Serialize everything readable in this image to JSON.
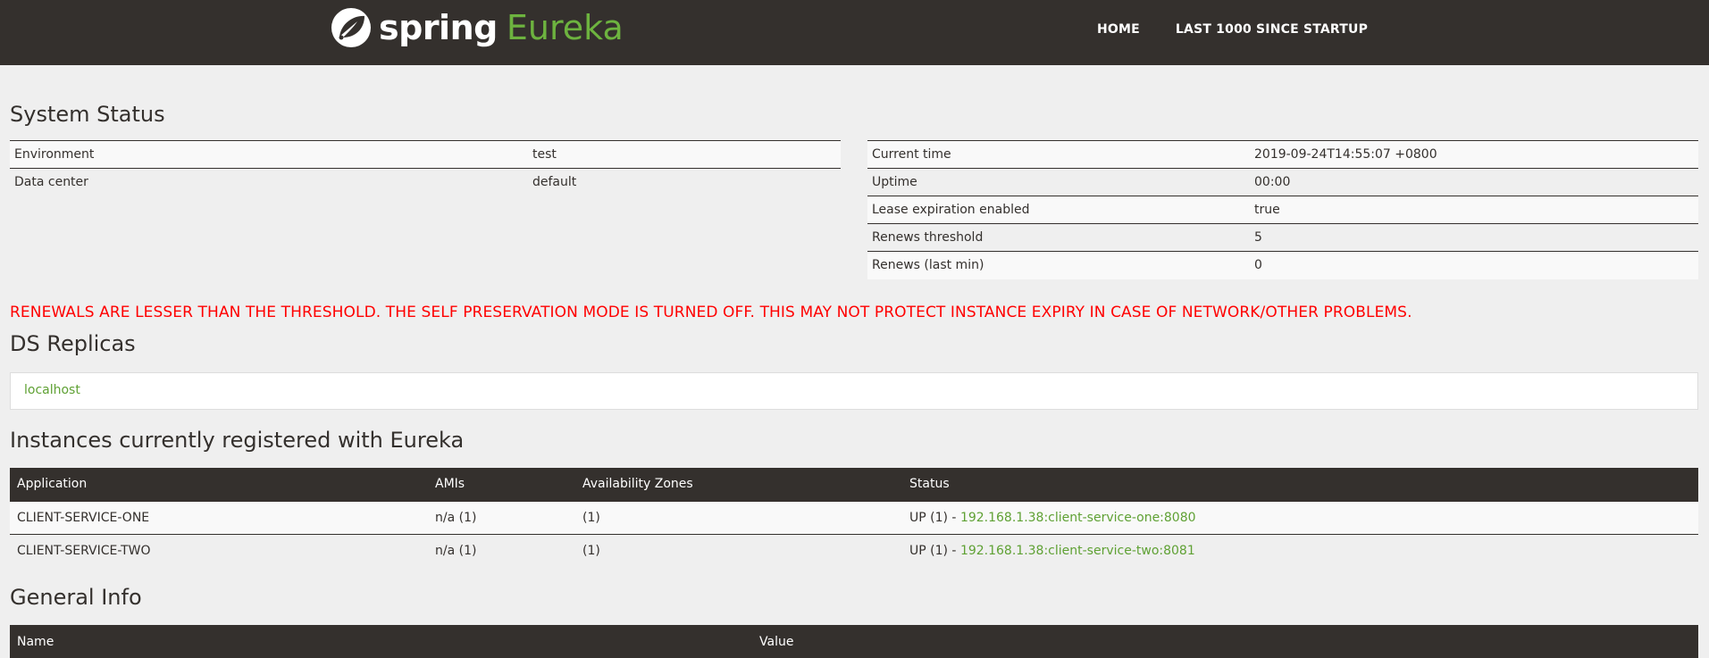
{
  "navbar": {
    "brand_primary": "spring",
    "brand_secondary": "Eureka",
    "links": [
      "HOME",
      "LAST 1000 SINCE STARTUP"
    ]
  },
  "system_status": {
    "title": "System Status",
    "left_rows": [
      {
        "label": "Environment",
        "value": "test"
      },
      {
        "label": "Data center",
        "value": "default"
      }
    ],
    "right_rows": [
      {
        "label": "Current time",
        "value": "2019-09-24T14:55:07 +0800"
      },
      {
        "label": "Uptime",
        "value": "00:00"
      },
      {
        "label": "Lease expiration enabled",
        "value": "true"
      },
      {
        "label": "Renews threshold",
        "value": "5"
      },
      {
        "label": "Renews (last min)",
        "value": "0"
      }
    ]
  },
  "warning": "RENEWALS ARE LESSER THAN THE THRESHOLD. THE SELF PRESERVATION MODE IS TURNED OFF. THIS MAY NOT PROTECT INSTANCE EXPIRY IN CASE OF NETWORK/OTHER PROBLEMS.",
  "ds_replicas": {
    "title": "DS Replicas",
    "items": [
      "localhost"
    ]
  },
  "instances": {
    "title": "Instances currently registered with Eureka",
    "columns": [
      "Application",
      "AMIs",
      "Availability Zones",
      "Status"
    ],
    "rows": [
      {
        "application": "CLIENT-SERVICE-ONE",
        "amis": "n/a (1)",
        "zones": "(1)",
        "status_prefix": "UP (1) - ",
        "status_link": "192.168.1.38:client-service-one:8080"
      },
      {
        "application": "CLIENT-SERVICE-TWO",
        "amis": "n/a (1)",
        "zones": "(1)",
        "status_prefix": "UP (1) - ",
        "status_link": "192.168.1.38:client-service-two:8081"
      }
    ]
  },
  "general_info": {
    "title": "General Info",
    "columns": [
      "Name",
      "Value"
    ]
  },
  "colors": {
    "navbar_bg": "#34302d",
    "accent_green": "#6db33f",
    "warning_red": "#ff0000",
    "page_bg": "#efefef"
  }
}
